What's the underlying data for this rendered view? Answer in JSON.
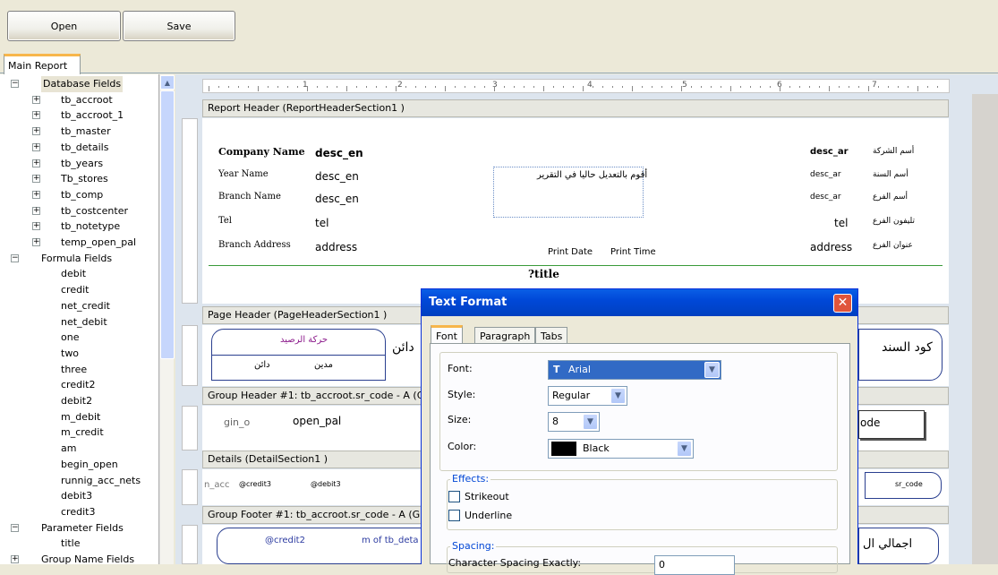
{
  "toolbar": {
    "open_label": "Open",
    "save_label": "Save"
  },
  "tabs": {
    "main_report": "Main Report"
  },
  "tree": {
    "database_fields": "Database Fields",
    "db_items": [
      "tb_accroot",
      "tb_accroot_1",
      "tb_master",
      "tb_details",
      "tb_years",
      "Tb_stores",
      "tb_comp",
      "tb_costcenter",
      "tb_notetype",
      "temp_open_pal"
    ],
    "formula_fields": "Formula Fields",
    "formula_items": [
      "debit",
      "credit",
      "net_credit",
      "net_debit",
      "one",
      "two",
      "three",
      "credit2",
      "debit2",
      "m_debit",
      "m_credit",
      "am",
      "begin_open",
      "runnig_acc_nets",
      "debit3",
      "credit3"
    ],
    "parameter_fields": "Parameter Fields",
    "parameter_items": [
      "title"
    ],
    "group_name_fields": "Group Name Fields"
  },
  "ruler": {
    "marks": [
      "1",
      "2",
      "3",
      "4",
      "5",
      "6",
      "7"
    ]
  },
  "sections": {
    "report_header": "Report Header  (ReportHeaderSection1 )",
    "page_header": "Page Header  (PageHeaderSection1 )",
    "group_header": "Group Header #1: tb_accroot.sr_code - A (Gr",
    "details": "Details  (DetailSection1 )",
    "group_footer": "Group Footer #1: tb_accroot.sr_code - A (Gro"
  },
  "report_header": {
    "labels": [
      "Company Name",
      "Year Name",
      "Branch Name",
      "Tel",
      "Branch Address"
    ],
    "values_en": [
      "desc_en",
      "desc_en",
      "desc_en",
      "tel",
      "address"
    ],
    "values_ar": [
      "desc_ar",
      "desc_ar",
      "desc_ar",
      "tel",
      "address"
    ],
    "labels_ar": [
      "أسم الشركة",
      "أسم السنة",
      "أسم الفرع",
      "تليفون الفرع",
      "عنوان الفرع"
    ],
    "note_ar": "أقوم بالتعديل حاليا في التقرير",
    "print_date": "Print Date",
    "print_time": "Print Time",
    "title": "?title"
  },
  "page_header": {
    "box_title_ar": "حركة الرصيد",
    "credit_ar": "دائن",
    "debit_ar": "مدين",
    "credit2_ar": "دائن",
    "code_ar": "كود السند"
  },
  "group_header": {
    "begin_open": "gin_o",
    "open_pal": "open_pal",
    "sr_code": "ode"
  },
  "details": {
    "fields": [
      "n_acc",
      "@credit3",
      "@debit3"
    ],
    "sr_code": "sr_code"
  },
  "group_footer": {
    "credit2": "@credit2",
    "sum": "m of tb_deta",
    "total_ar": "اجمالي ال"
  },
  "dialog": {
    "title": "Text Format",
    "tabs": [
      "Font",
      "Paragraph",
      "Tabs"
    ],
    "font_label": "Font:",
    "font_value": "Arial",
    "style_label": "Style:",
    "style_value": "Regular",
    "size_label": "Size:",
    "size_value": "8",
    "color_label": "Color:",
    "color_value": "Black",
    "color_swatch": "#000000",
    "effects_label": "Effects:",
    "strikeout": "Strikeout",
    "underline": "Underline",
    "spacing_label": "Spacing:",
    "char_spacing": "Character Spacing Exactly:",
    "char_spacing_value": "0"
  },
  "colors": {
    "accent": "#0054e3",
    "selection": "#316ac5",
    "section_line": "#3a9a3a"
  }
}
